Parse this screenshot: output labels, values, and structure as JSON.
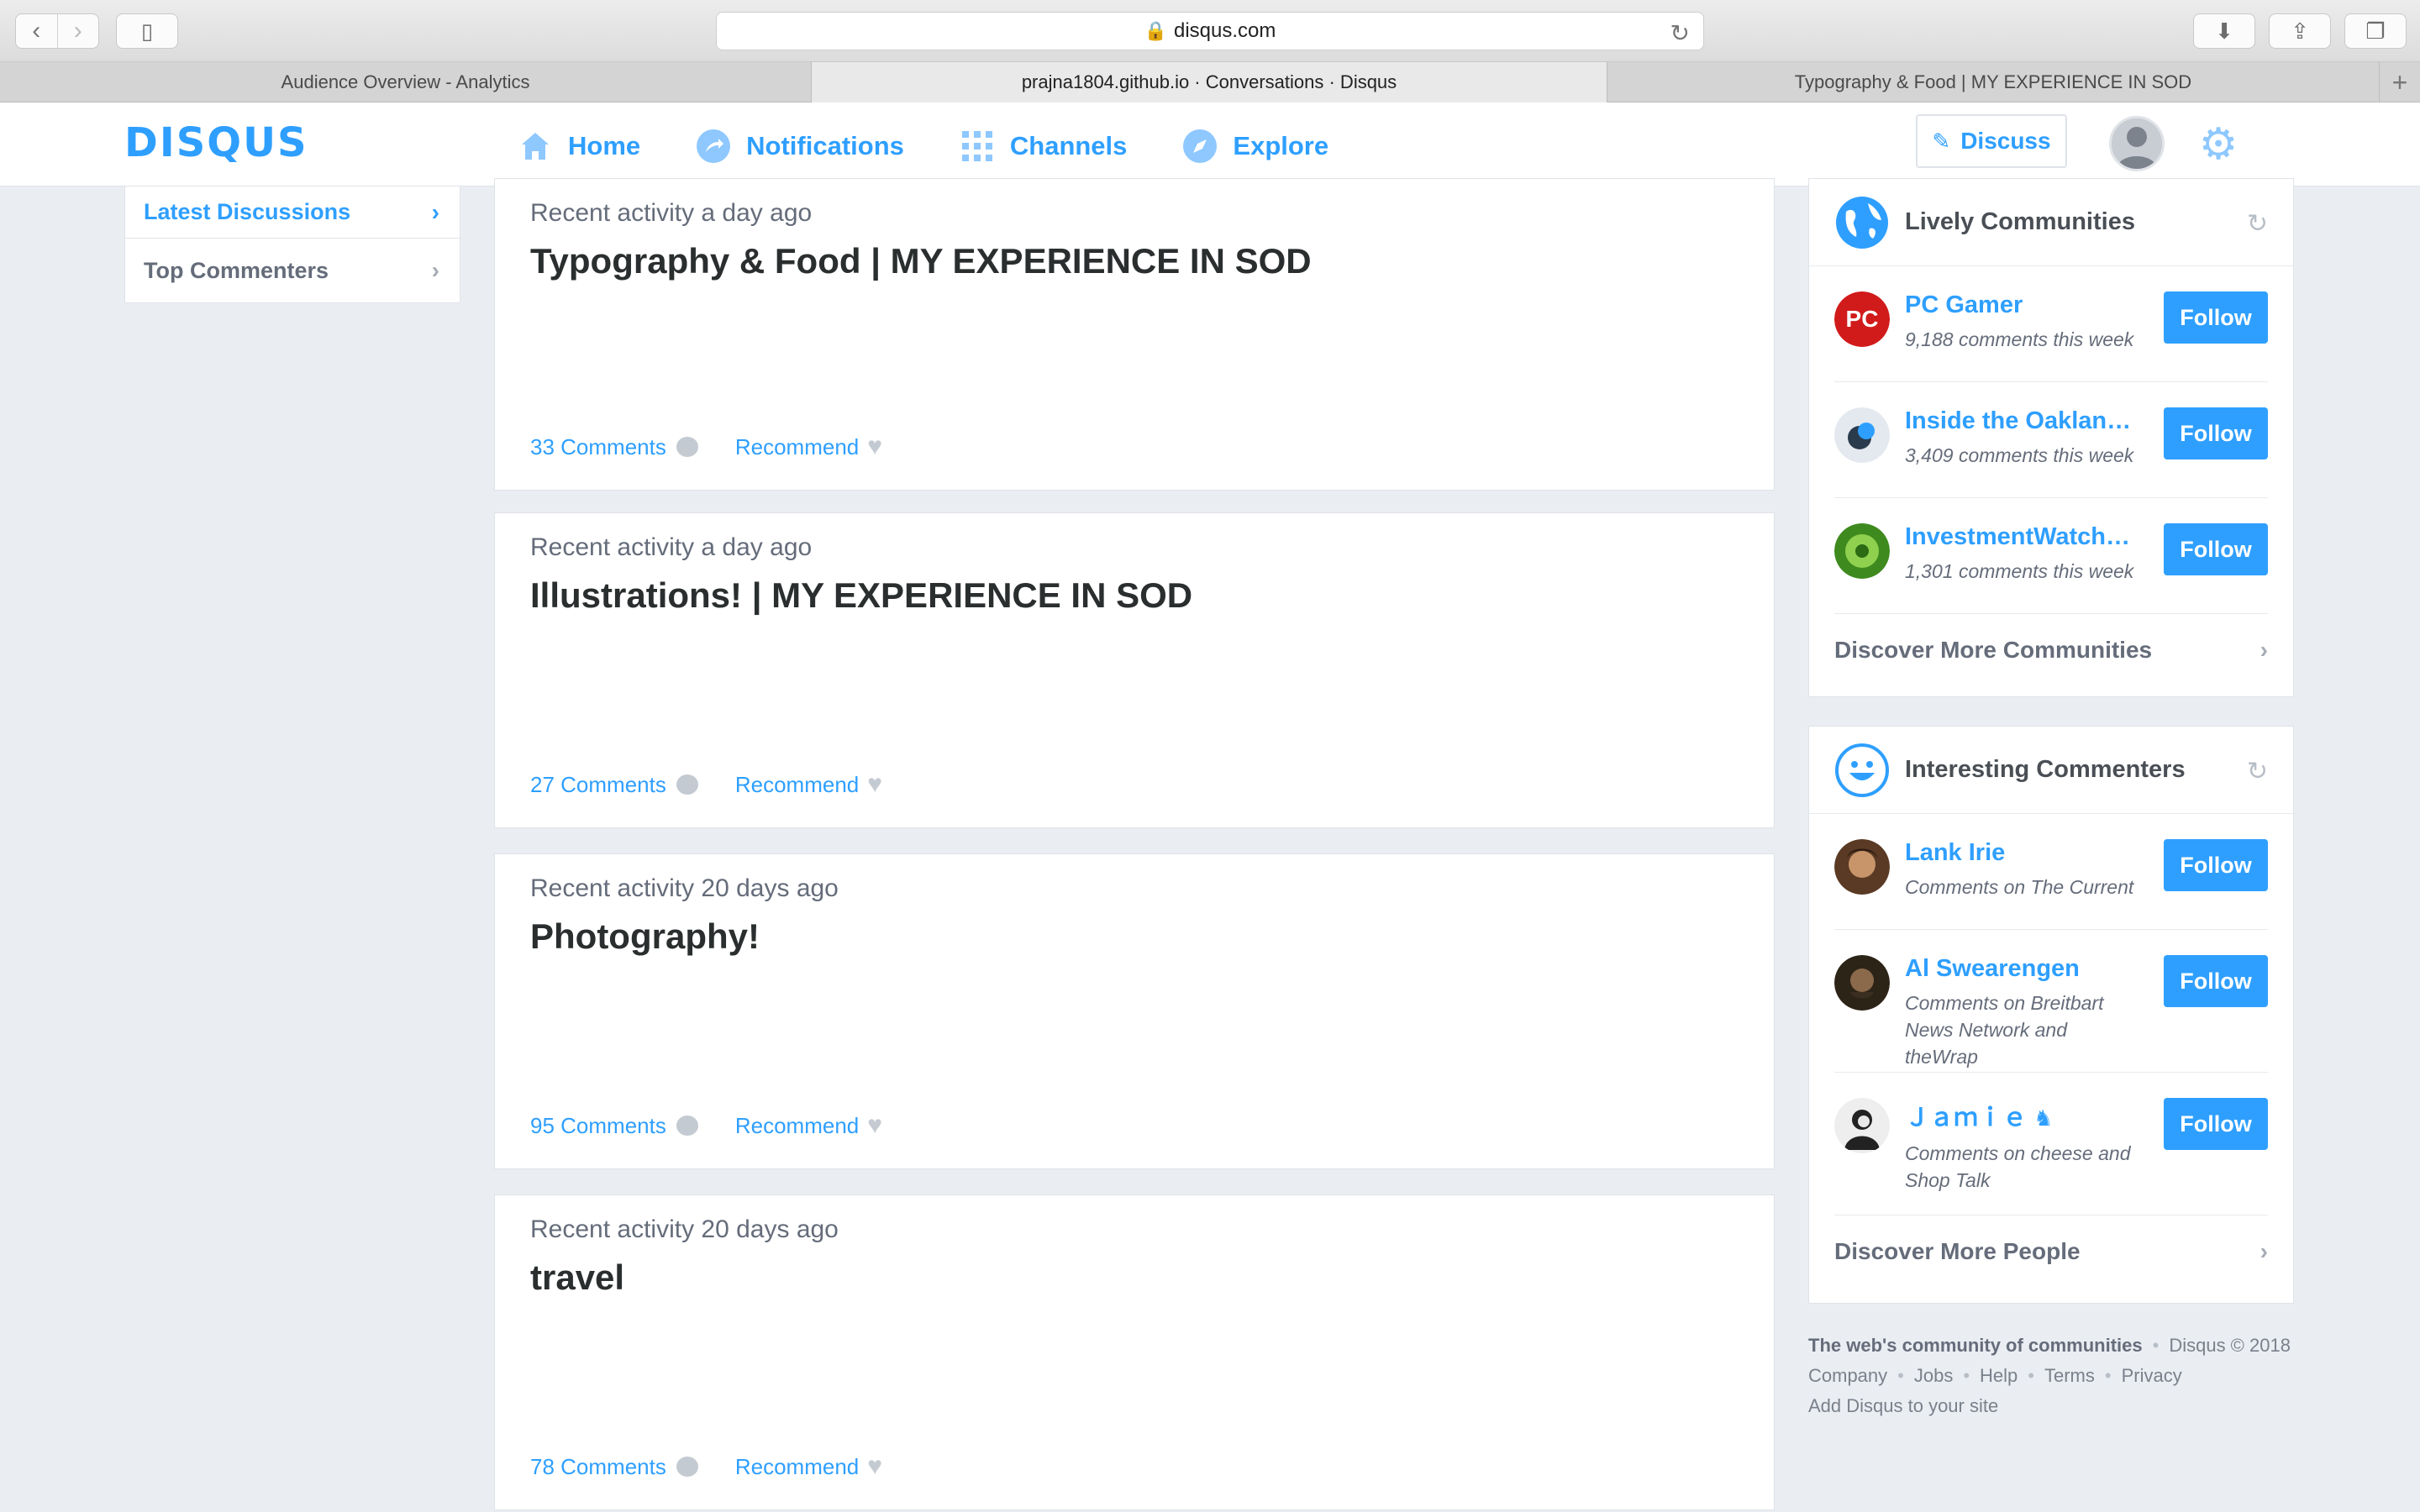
{
  "browser": {
    "url": "disqus.com",
    "tabs": [
      {
        "label": "Audience Overview - Analytics"
      },
      {
        "label": "prajna1804.github.io · Conversations · Disqus"
      },
      {
        "label": "Typography & Food | MY EXPERIENCE IN SOD"
      }
    ]
  },
  "header": {
    "logo": "DISQUS",
    "nav": [
      {
        "label": "Home"
      },
      {
        "label": "Notifications"
      },
      {
        "label": "Channels"
      },
      {
        "label": "Explore"
      }
    ],
    "discuss_label": "Discuss"
  },
  "left_nav": {
    "items": [
      {
        "label": "Latest Discussions"
      },
      {
        "label": "Top Commenters"
      }
    ]
  },
  "feed": [
    {
      "meta": "Recent activity a day ago",
      "title": "Typography & Food | MY EXPERIENCE IN SOD",
      "comments": "33 Comments",
      "recommend": "Recommend"
    },
    {
      "meta": "Recent activity a day ago",
      "title": "Illustrations! | MY EXPERIENCE IN SOD",
      "comments": "27 Comments",
      "recommend": "Recommend"
    },
    {
      "meta": "Recent activity 20 days ago",
      "title": "Photography!",
      "comments": "95 Comments",
      "recommend": "Recommend"
    },
    {
      "meta": "Recent activity 20 days ago",
      "title": "travel",
      "comments": "78 Comments",
      "recommend": "Recommend"
    }
  ],
  "communities": {
    "title": "Lively Communities",
    "items": [
      {
        "name": "PC Gamer",
        "sub": "9,188 comments this week",
        "follow": "Follow"
      },
      {
        "name": "Inside the Oakland ...",
        "sub": "3,409 comments this week",
        "follow": "Follow"
      },
      {
        "name": "InvestmentWatchB...",
        "sub": "1,301 comments this week",
        "follow": "Follow"
      }
    ],
    "more": "Discover More Communities"
  },
  "commenters": {
    "title": "Interesting Commenters",
    "items": [
      {
        "name": "Lank Irie",
        "sub": "Comments on The Current",
        "follow": "Follow"
      },
      {
        "name": "Al Swearengen",
        "sub": "Comments on Breitbart News Network and theWrap",
        "follow": "Follow"
      },
      {
        "name": "Ｊａｍｉｅ",
        "sub": "Comments on cheese and Shop Talk",
        "follow": "Follow"
      }
    ],
    "more": "Discover More People"
  },
  "footer": {
    "tagline": "The web's community of communities",
    "copyright": "Disqus © 2018",
    "links": [
      "Company",
      "Jobs",
      "Help",
      "Terms",
      "Privacy"
    ],
    "add": "Add Disqus to your site"
  },
  "colors": {
    "accent": "#2e9fff",
    "follow_bg": "#2e9fff",
    "page_bg": "#eaedf2"
  }
}
